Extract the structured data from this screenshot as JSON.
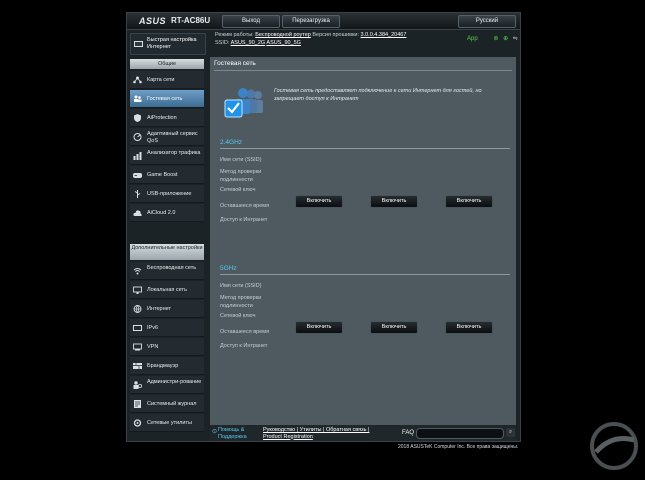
{
  "header": {
    "brand": "ASUS",
    "model": "RT-AC86U",
    "logout": "Выход",
    "reboot": "Перезагрузка",
    "language": "Русский"
  },
  "info": {
    "mode_label": "Режим работы:",
    "mode_value": "Беспроводной роутер",
    "firmware_label": "Версия прошивки:",
    "firmware_value": "3.0.0.4.384_20467",
    "ssid_label": "SSID:",
    "ssid_1": "ASUS_90_2G",
    "ssid_2": "ASUS_90_5G",
    "app_label": "App"
  },
  "sidebar": {
    "quick_setup": "Быстрая настройка Интернет",
    "general_header": "Общие",
    "general_items": [
      {
        "label": "Карта сети",
        "icon": "network-map-icon"
      },
      {
        "label": "Гостевая сеть",
        "icon": "guest-network-icon",
        "active": true
      },
      {
        "label": "AiProtection",
        "icon": "shield-icon"
      },
      {
        "label": "Адаптивный сервис QoS",
        "icon": "qos-icon"
      },
      {
        "label": "Анализатор трафика",
        "icon": "traffic-analyzer-icon"
      },
      {
        "label": "Game Boost",
        "icon": "gamepad-icon"
      },
      {
        "label": "USB-приложение",
        "icon": "usb-icon"
      },
      {
        "label": "AiCloud 2.0",
        "icon": "cloud-icon"
      }
    ],
    "advanced_header": "Дополнительные настройки",
    "advanced_items": [
      {
        "label": "Беспроводная сеть",
        "icon": "wireless-icon"
      },
      {
        "label": "Локальная сеть",
        "icon": "lan-icon"
      },
      {
        "label": "Интернет",
        "icon": "globe-icon"
      },
      {
        "label": "IPv6",
        "icon": "ipv6-icon"
      },
      {
        "label": "VPN",
        "icon": "vpn-icon"
      },
      {
        "label": "Брандмауэр",
        "icon": "firewall-icon"
      },
      {
        "label": "Администри-рование",
        "icon": "administration-icon"
      },
      {
        "label": "Системный журнал",
        "icon": "system-log-icon"
      },
      {
        "label": "Сетевые утилиты",
        "icon": "network-tools-icon"
      }
    ]
  },
  "main": {
    "title": "Гостевая сеть",
    "description": "Гостевая сеть предоставляет подключение к сети Интернет для гостей, но запрещает доступ к Интранет",
    "bands": [
      {
        "name": "2.4GHz",
        "labels": [
          "Имя сети (SSID)",
          "Метод проверки подлинности",
          "Сетевой ключ",
          "Оставшееся время",
          "Доступ к Интранет"
        ],
        "buttons": [
          "Включить",
          "Включить",
          "Включить"
        ]
      },
      {
        "name": "5GHz",
        "labels": [
          "Имя сети (SSID)",
          "Метод проверки подлинности",
          "Сетевой ключ",
          "Оставшееся время",
          "Доступ к Интранет"
        ],
        "buttons": [
          "Включить",
          "Включить",
          "Включить"
        ]
      }
    ]
  },
  "footer": {
    "help": "Помощь & Поддержка",
    "links": "Руководство | Утилиты | Обратная связь | Product Registration",
    "faq": "FAQ",
    "copyright": "2018 ASUSTeK Computer Inc. Все права защищены."
  },
  "colors": {
    "accent": "#5cc6ef",
    "active_item": "#4f80a8",
    "content_bg": "#4e5a60"
  }
}
